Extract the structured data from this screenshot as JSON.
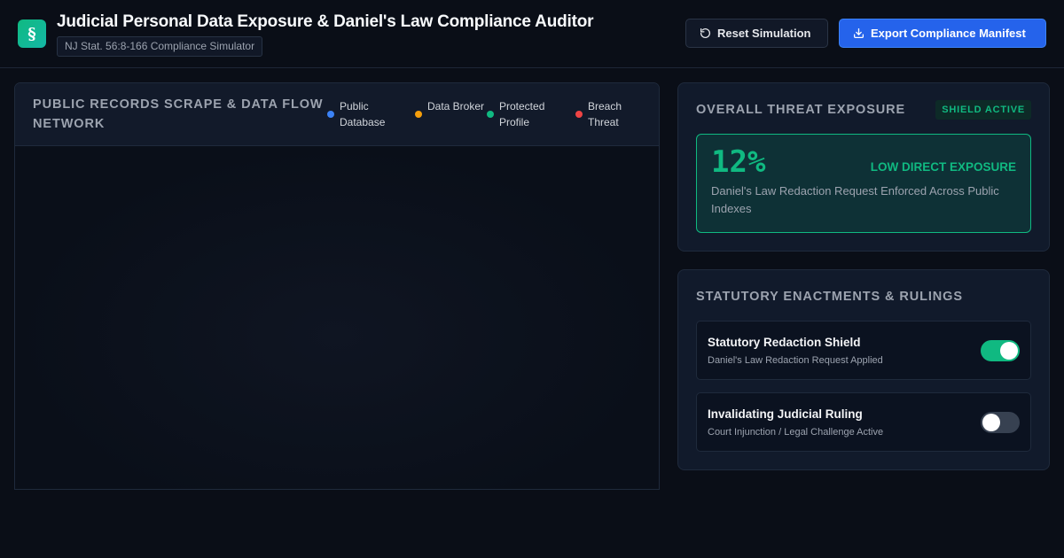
{
  "header": {
    "logo_glyph": "§",
    "title": "Judicial Personal Data Exposure & Daniel's Law Compliance Auditor",
    "subtitle": "NJ Stat. 56:8-166 Compliance Simulator",
    "reset_label": "Reset Simulation",
    "reset_icon": "refresh-icon",
    "export_label": "Export Compliance Manifest",
    "export_icon": "download-icon"
  },
  "network": {
    "title": "Public Records Scrape & Data Flow Network",
    "legend": [
      {
        "label": "Public Database",
        "color": "#3b82f6"
      },
      {
        "label": "Data Broker",
        "color": "#f59e0b"
      },
      {
        "label": "Protected Profile",
        "color": "#10b981"
      },
      {
        "label": "Breach Threat",
        "color": "#ef4444"
      }
    ]
  },
  "threat": {
    "title": "Overall Threat Exposure",
    "badge": "SHIELD ACTIVE",
    "value": "12%",
    "level": "LOW DIRECT EXPOSURE",
    "description": "Daniel's Law Redaction Request Enforced Across Public Indexes",
    "accent_color": "#10b981"
  },
  "statutes": {
    "title": "Statutory Enactments & Rulings",
    "items": [
      {
        "label": "Statutory Redaction Shield",
        "sublabel": "Daniel's Law Redaction Request Applied",
        "state": "on"
      },
      {
        "label": "Invalidating Judicial Ruling",
        "sublabel": "Court Injunction / Legal Challenge Active",
        "state": "off"
      }
    ]
  }
}
